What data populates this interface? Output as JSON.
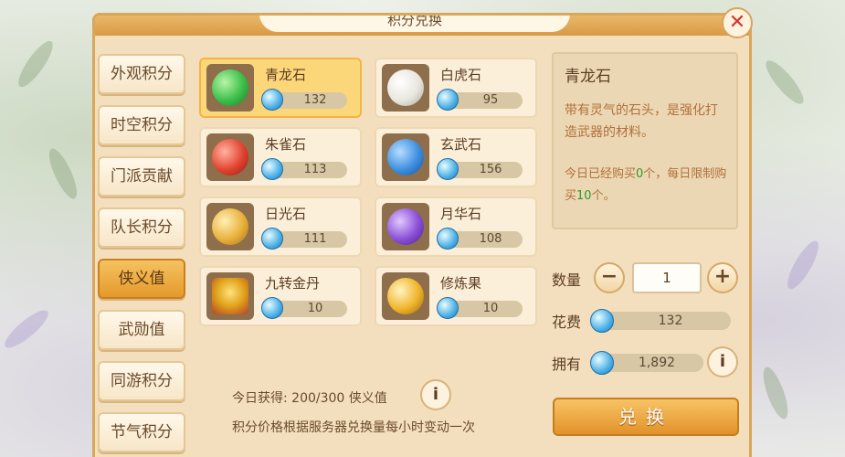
{
  "window": {
    "title": "积分兑换"
  },
  "sidebar": {
    "items": [
      {
        "label": "外观积分",
        "active": false
      },
      {
        "label": "时空积分",
        "active": false
      },
      {
        "label": "门派贡献",
        "active": false
      },
      {
        "label": "队长积分",
        "active": false
      },
      {
        "label": "侠义值",
        "active": true
      },
      {
        "label": "武勋值",
        "active": false
      },
      {
        "label": "同游积分",
        "active": false
      },
      {
        "label": "节气积分",
        "active": false
      }
    ]
  },
  "items": [
    {
      "name": "青龙石",
      "price": "132",
      "icon": "green-dragon-stone-icon",
      "color": "#3bbf4a",
      "active": true
    },
    {
      "name": "白虎石",
      "price": "95",
      "icon": "white-tiger-stone-icon",
      "color": "#e8e6df",
      "active": false
    },
    {
      "name": "朱雀石",
      "price": "113",
      "icon": "vermilion-bird-stone-icon",
      "color": "#e2432f",
      "active": false
    },
    {
      "name": "玄武石",
      "price": "156",
      "icon": "black-tortoise-stone-icon",
      "color": "#3d8fe0",
      "active": false
    },
    {
      "name": "日光石",
      "price": "111",
      "icon": "sunlight-stone-icon",
      "color": "#e8b13a",
      "active": false
    },
    {
      "name": "月华石",
      "price": "108",
      "icon": "moonlight-stone-icon",
      "color": "#8a4fd6",
      "active": false
    },
    {
      "name": "九转金丹",
      "price": "10",
      "icon": "golden-elixir-icon",
      "color": "#e0a11a",
      "active": false
    },
    {
      "name": "修炼果",
      "price": "10",
      "icon": "cultivation-fruit-icon",
      "color": "#f0b52a",
      "active": false
    }
  ],
  "detail": {
    "name": "青龙石",
    "description": "带有灵气的石头，是强化打造武器的材料。",
    "limit_prefix": "今日已经购买",
    "bought": "0",
    "limit_mid": "个，每日限制购买",
    "limit_max": "10",
    "limit_suffix": "个。"
  },
  "purchase": {
    "qty_label": "数量",
    "qty_value": "1",
    "cost_label": "花费",
    "cost_value": "132",
    "own_label": "拥有",
    "own_value": "1,892",
    "exchange_label": "兑换"
  },
  "footer": {
    "daily": "今日获得: 200/300 侠义值",
    "note": "积分价格根据服务器兑换量每小时变动一次"
  }
}
